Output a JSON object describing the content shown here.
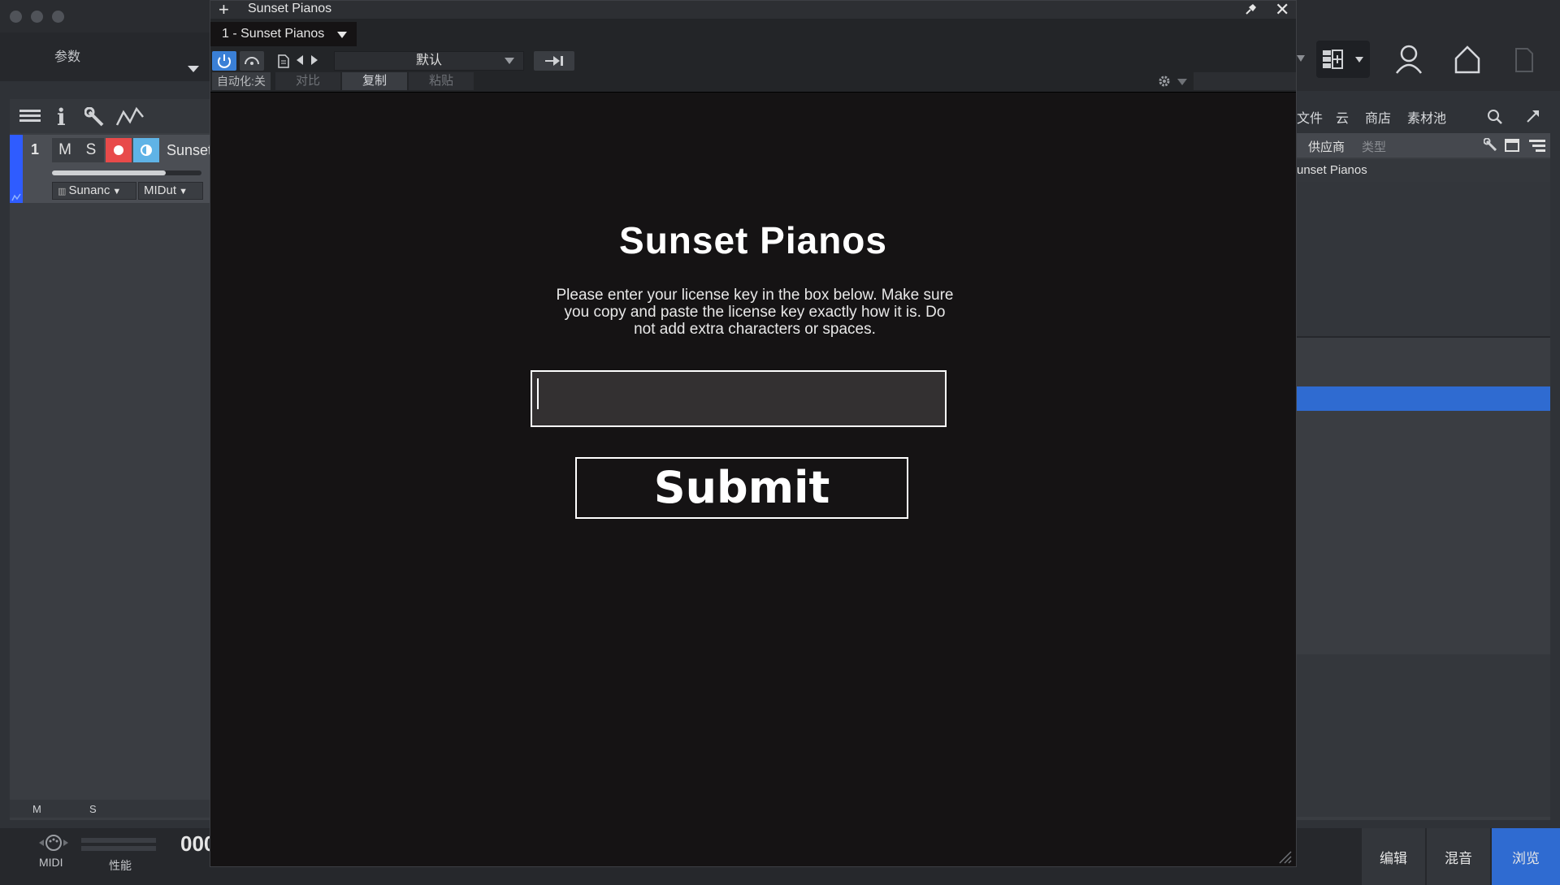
{
  "host": {
    "params_label": "参数",
    "track": {
      "number": "1",
      "mute": "M",
      "solo": "S",
      "name": "Sunset",
      "instrument": "Sunanc",
      "midi": "MIDut",
      "fader_level": 0.76
    },
    "footer": {
      "m": "M",
      "s": "S"
    },
    "transport": {
      "midi_label": "MIDI",
      "perf_label": "性能",
      "timecode": "000"
    },
    "bottom_tabs": [
      "编辑",
      "混音",
      "浏览"
    ],
    "browser": {
      "tabs": [
        "文件",
        "云",
        "商店",
        "素材池"
      ],
      "columns": {
        "vendor": "供应商",
        "type": "类型"
      },
      "item": "unset Pianos"
    },
    "colors": {
      "accent": "#2f6bd1",
      "track_color": "#2f5cff",
      "record": "#e84a4a",
      "monitor": "#5fb3e6"
    }
  },
  "plugin": {
    "window_title": "Sunset Pianos",
    "preset_tab": "1 - Sunset Pianos",
    "preset_name": "默认",
    "automation_label": "自动化:关",
    "compare_label": "对比",
    "copy_label": "复制",
    "paste_label": "粘贴",
    "ui": {
      "title": "Sunset Pianos",
      "description": "Please enter your license key in the box below. Make sure you copy and paste the license key exactly how it is. Do not add extra characters or spaces.",
      "license_input_value": "",
      "submit_label": "Submit"
    }
  }
}
